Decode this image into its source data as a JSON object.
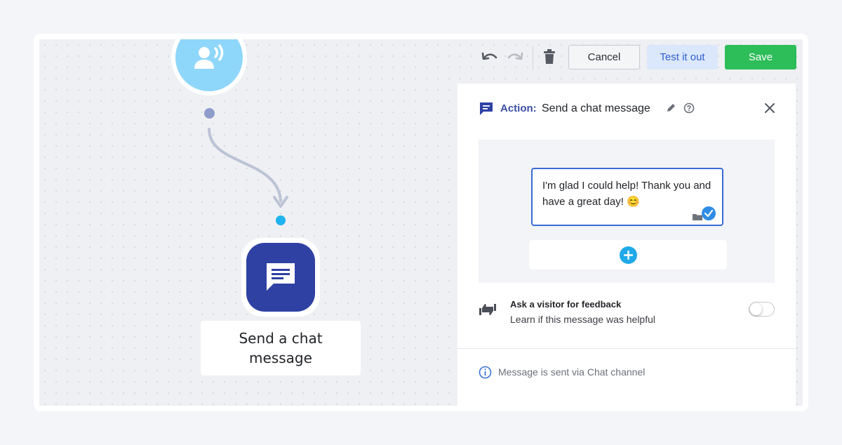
{
  "toolbar": {
    "undo_icon": "undo-icon",
    "redo_icon": "redo-icon",
    "delete_icon": "trash-icon",
    "cancel_label": "Cancel",
    "test_label": "Test it out",
    "save_label": "Save"
  },
  "canvas": {
    "trigger_icon": "visitor-speaking-icon",
    "action_icon": "chat-message-icon",
    "action_node_label": "Send a chat message"
  },
  "panel": {
    "header_prefix": "Action:",
    "header_title": "Send a chat message",
    "message_text": "I'm glad I could help! Thank you and have a great day! 😊",
    "feedback_title": "Ask a visitor for feedback",
    "feedback_subtitle": "Learn if this message was helpful",
    "feedback_enabled": false,
    "info_text": "Message is sent via Chat channel"
  },
  "colors": {
    "accent_navy": "#2f41a3",
    "save_green": "#2dbd59",
    "test_blue_bg": "#dbe8fb",
    "trigger_light_blue": "#8fd6fb",
    "add_button_blue": "#1fa9e8"
  }
}
